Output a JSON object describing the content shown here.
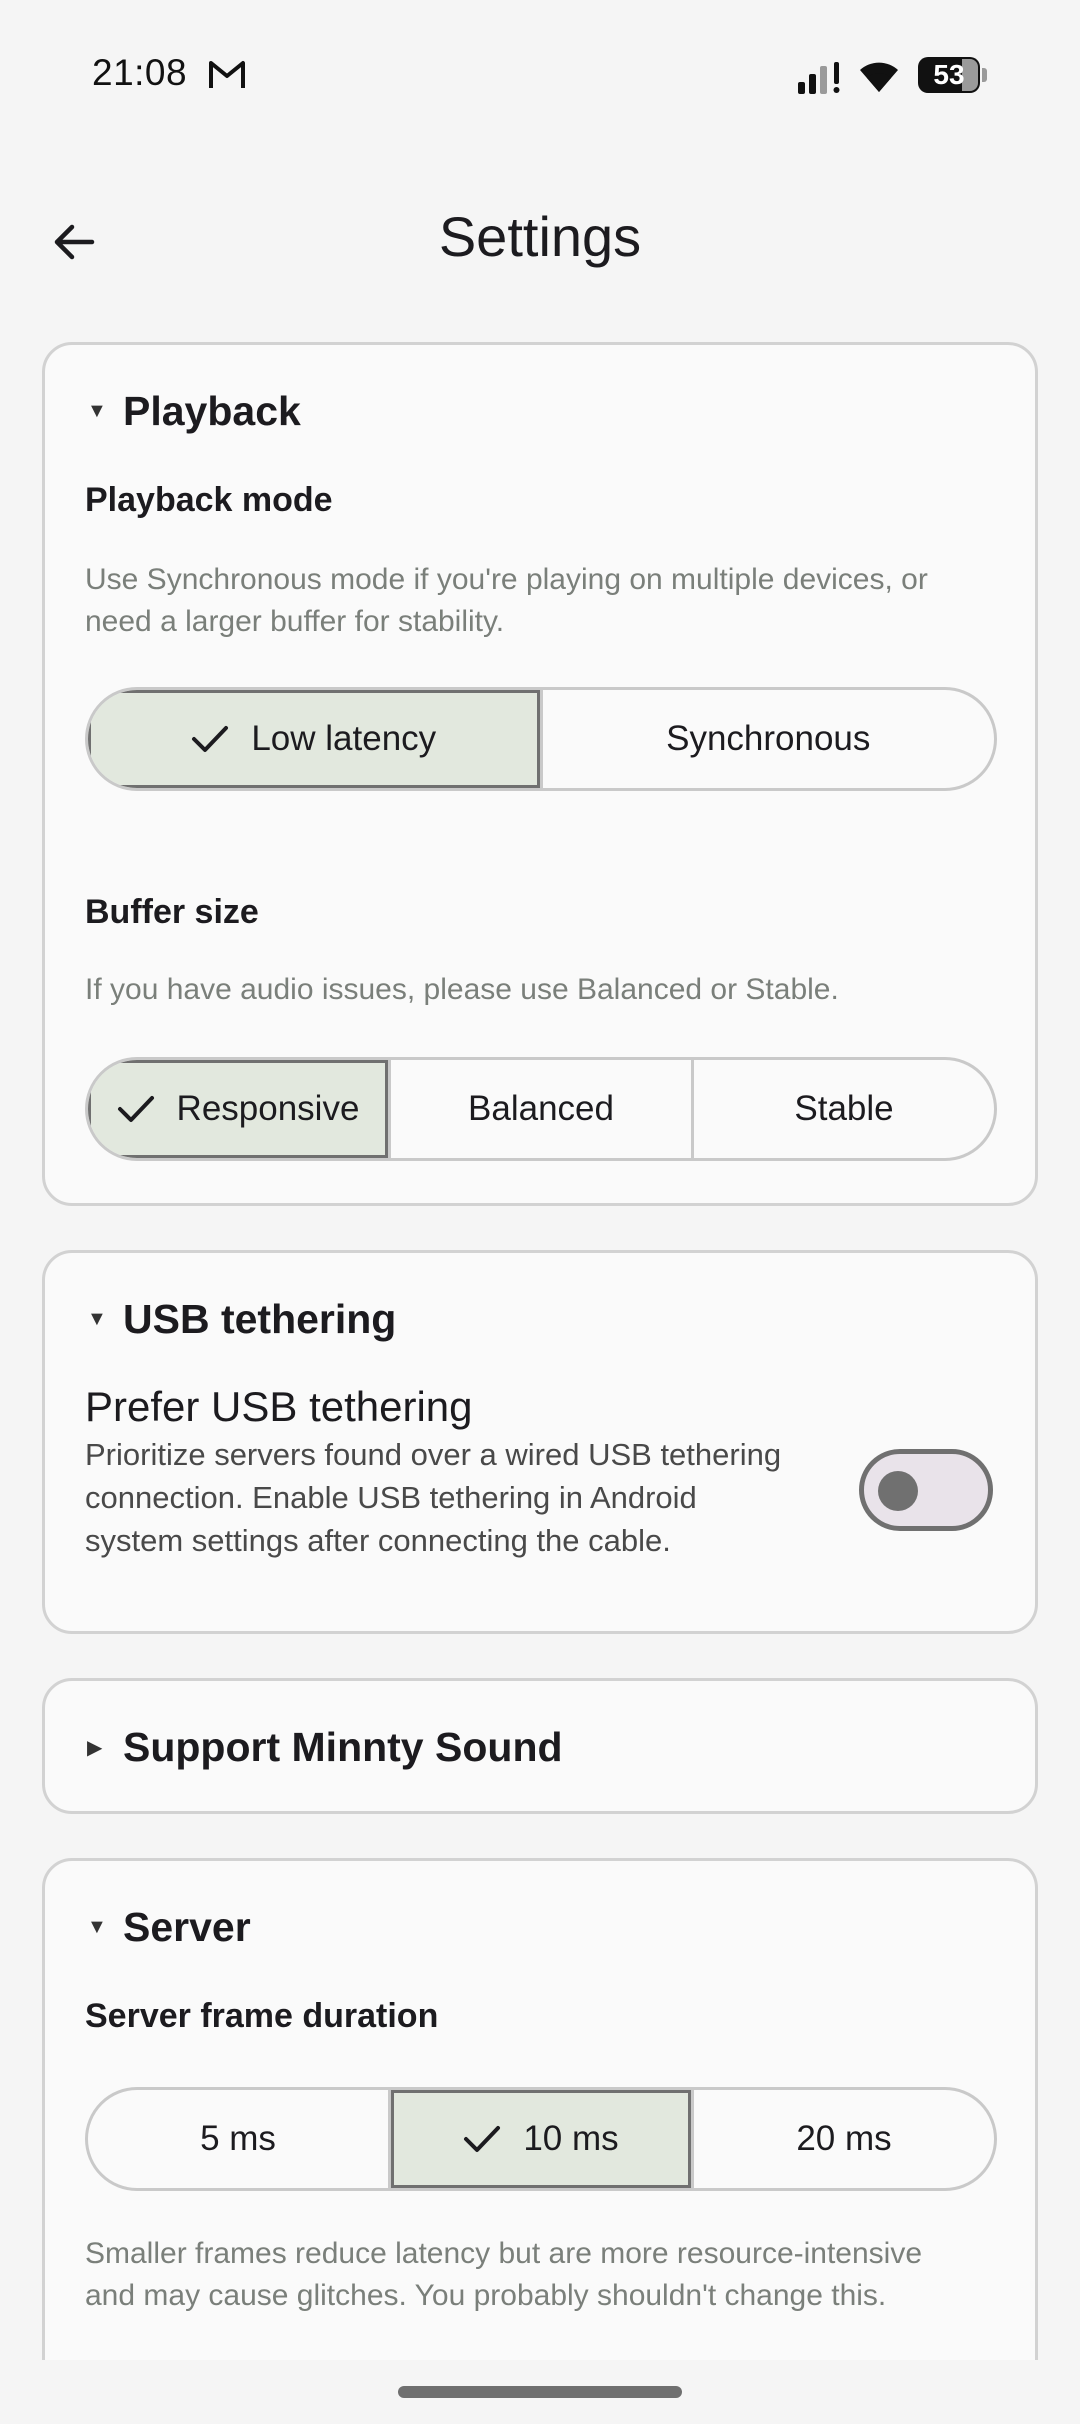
{
  "status_bar": {
    "time": "21:08",
    "battery": "53",
    "icons": [
      "gmail-icon",
      "signal-icon",
      "wifi-icon",
      "battery-icon"
    ]
  },
  "app_bar": {
    "back_icon": "arrow-back-icon",
    "title": "Settings"
  },
  "playback": {
    "title": "Playback",
    "mode_title": "Playback mode",
    "mode_desc": "Use Synchronous mode if you're playing on multiple devices, or need a larger buffer for stability.",
    "mode_options": [
      "Low latency",
      "Synchronous"
    ],
    "mode_selected": "Low latency",
    "buffer_title": "Buffer size",
    "buffer_desc": "If you have audio issues, please use Balanced or Stable.",
    "buffer_options": [
      "Responsive",
      "Balanced",
      "Stable"
    ],
    "buffer_selected": "Responsive"
  },
  "usb": {
    "title": "USB tethering",
    "pref_title": "Prefer USB tethering",
    "pref_desc": "Prioritize servers found over a wired USB tethering connection. Enable USB tethering in Android system settings after connecting the cable.",
    "enabled": false
  },
  "support": {
    "title": "Support Minnty Sound",
    "expanded": false
  },
  "server": {
    "title": "Server",
    "frame_title": "Server frame duration",
    "frame_options": [
      "5 ms",
      "10 ms",
      "20 ms"
    ],
    "frame_selected": "10 ms",
    "frame_desc": "Smaller frames reduce latency but are more resource-intensive and may cause glitches. You probably shouldn't change this."
  },
  "colors": {
    "selected_segment": "#e2e8de",
    "card_border": "#d2d2d2",
    "secondary_text": "#7a7f7a"
  }
}
